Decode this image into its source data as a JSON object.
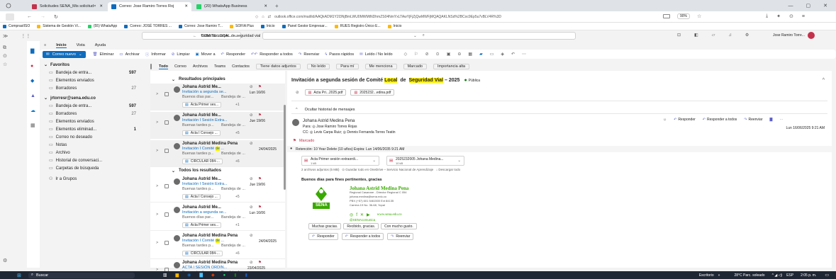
{
  "browser": {
    "tabs": [
      {
        "label": "Solicitudes SENA_Mis solicitud×",
        "color": "#c4314b"
      },
      {
        "label": "Correo: Jose Ramiro Torres Roj",
        "color": "#0f6cbd"
      },
      {
        "label": "(20) WhatsApp Business",
        "color": "#25d366"
      }
    ],
    "url": "outlook.office.com/mail/id/AAQkADM1Y2I3NjBmLWU0MWMtNDhmZS04NmYxLTAwYjFjZjQwMWFjMQAQAKLNSd%2BCoc9Ep5u7vBLV4R%3D",
    "zoom": "90%",
    "bookmarks": [
      "ComprasIISO",
      "Sistema de Gestión Vi...",
      "(55) WhatsApp",
      "Correo: JOSÉ TORRES ...",
      "Correo: Jose Ramiro T...",
      "SOFIA Plus",
      "Inicio",
      "Panel Gestor Empresar...",
      "RUES Registro Único E...",
      "Inicio"
    ]
  },
  "outlook": {
    "search_scope": "Todas las carpe...",
    "search_back": "COMITE LOCAL de seguridad vial",
    "user": "Jose Ramiro Torre...",
    "ribbon_tabs": [
      "Inicio",
      "Vista",
      "Ayuda"
    ],
    "new_mail": "Correo nuevo",
    "actions": [
      "Eliminar",
      "Archivar",
      "Informar",
      "Limpiar",
      "Mover a",
      "Responder",
      "Responder a todos",
      "Reenviar",
      "Pasos rápidos",
      "Leído / No leído"
    ],
    "folders": {
      "favorites": "Favoritos",
      "fav_items": [
        {
          "label": "Bandeja de entra...",
          "count": "597"
        },
        {
          "label": "Elementos enviados",
          "count": ""
        },
        {
          "label": "Borradores",
          "count": "27"
        }
      ],
      "account": "jrtorresr@sena.edu.co",
      "acc_items": [
        {
          "label": "Bandeja de entra...",
          "count": "597"
        },
        {
          "label": "Borradores",
          "count": "27"
        },
        {
          "label": "Elementos enviados",
          "count": ""
        },
        {
          "label": "Elementos eliminad...",
          "count": "1"
        },
        {
          "label": "Correo no deseado",
          "count": ""
        },
        {
          "label": "Notas",
          "count": ""
        },
        {
          "label": "Archivo",
          "count": ""
        },
        {
          "label": "Historial de conversaci...",
          "count": ""
        },
        {
          "label": "Carpetas de búsqueda",
          "count": ""
        }
      ],
      "groups": "Ir a Grupos"
    },
    "filters": [
      "Todo",
      "Correo",
      "Archivos",
      "Teams",
      "Contactos",
      "Tiene datos adjuntos",
      "No leído",
      "Para mí",
      "Me menciona",
      "Marcado",
      "Importancia alta"
    ],
    "list": {
      "top_header": "Resultados principales",
      "all_header": "Todos los resultados",
      "items": [
        {
          "who": "Johana Astrid Me...",
          "subj": "Invitación a segunda se...",
          "date": "Lun 16/06",
          "prev": "Buenos días par...",
          "prev2": "Bandeja de ...",
          "chip": "Acta Primer ses...",
          "plus": "+1"
        },
        {
          "who": "Johana Astrid Me...",
          "subj": "Invitación I Sesión Extra...",
          "date": "Jue 19/06",
          "prev": "Buenas tardes p...",
          "prev2": "Bandeja de ...",
          "chip": "Acta I Consejo ...",
          "plus": "+5"
        },
        {
          "who": "Johana Astrid Medina Pena",
          "subj_a": "Invitación I Comité ",
          "subj_hl": "de",
          "subj_b": " ...",
          "date": "24/04/2025",
          "prev": "Buenas tardes p...",
          "prev2": "Bandeja de ...",
          "chip": "CIRCULAR 084-...",
          "plus": "+6"
        },
        {
          "who": "Johana Astrid Me...",
          "subj": "Invitación I Sesión Extra...",
          "date": "Jue 19/06",
          "prev": "Buenas tardes p...",
          "prev2": "Bandeja de ...",
          "chip": "Acta I Consejo ...",
          "plus": "+5"
        },
        {
          "who": "Johana Astrid Me...",
          "subj": "Invitación a segunda se...",
          "date": "Lun 16/06",
          "prev": "Buenos días par...",
          "prev2": "Bandeja de ...",
          "chip": "Acta Primer ses...",
          "plus": "+1"
        },
        {
          "who": "Johana Astrid Medina Pena",
          "subj_a": "Invitación I Comité ",
          "subj_hl": "de",
          "subj_b": " ...",
          "date": "24/04/2025",
          "prev": "Buenas tardes p...",
          "prev2": "Bandeja de ...",
          "chip": "CIRCULAR 084-...",
          "plus": "+6"
        },
        {
          "who": "Johana Astrid Medina Pena",
          "subj": "ACTA I SESIÓN ORDIN...",
          "date": "23/04/2025",
          "prev": "Buenas tardes p...",
          "prev2": "Bandeja de ...",
          "chip": "",
          "plus": ""
        }
      ]
    },
    "reading": {
      "subject_a": "Invitación a segunda sesión de Comité ",
      "subject_hl1": "Local",
      "subject_mid": " de ",
      "subject_hl2": "Seguridad Vial",
      "subject_b": " – 2025",
      "visibility": "Pública",
      "top_attachments": [
        "Acta Pri...2025.pdf",
        "2025232...edina.pdf"
      ],
      "history_toggle": "Ocultar historial de mensajes",
      "sender": "Johana Astrid Medina Pena",
      "to": "Para: ◎ Jose Ramiro Torres Rojas",
      "cc": "CC: ◎ Levis Carpa Ruiz; ◎ Dennis Fernanda Torres Teatin",
      "msg_actions": [
        "Responder",
        "Responder a todos",
        "Reenviar"
      ],
      "msg_date": "Lun 16/06/2025 9:21 AM",
      "flag": "Marcado",
      "retention": "Retención: 10 Year Delete (10 años) Expira: Lun 14/06/2035 9:21 AM",
      "attachments": [
        {
          "name": "Acta Primer sesión extraordi...",
          "size": "1 kB"
        },
        {
          "name": "2025232005 Johana Medina...",
          "size": "10 kB"
        }
      ],
      "attach_summary": "2 archivos adjuntos (5 MB)   ⊙ Guardar todo en OneDrive – Servicio Nacional de Aprendizaje   ↓ Descargar todo",
      "greeting": "Buenos días para fines pertinentes, gracias",
      "sig_name": "Johana Astrid Medina Pena",
      "sig_lines": [
        "Regional Casanare - Director Regional C 054",
        "johana.medina@sena.edu.co",
        "PBX (+57) 601 5461500 Ext 84135",
        "Carrera 19 No. 36-68, Yopal"
      ],
      "sig_brand": "SENA",
      "sig_social": "@SENAcomunica",
      "sig_web": "www.sena.edu.co",
      "quick_replies": [
        "Muchas gracias.",
        "Recibido, gracias.",
        "Con mucho gusto."
      ],
      "bottom_actions": [
        "Responder",
        "Responder a todos",
        "Reenviar"
      ]
    }
  },
  "taskbar": {
    "search": "Buscar",
    "desk": "Escritorio",
    "weather": "28°C  Parc. soleado",
    "lang": "ESP",
    "time": "2:05 p. m."
  }
}
